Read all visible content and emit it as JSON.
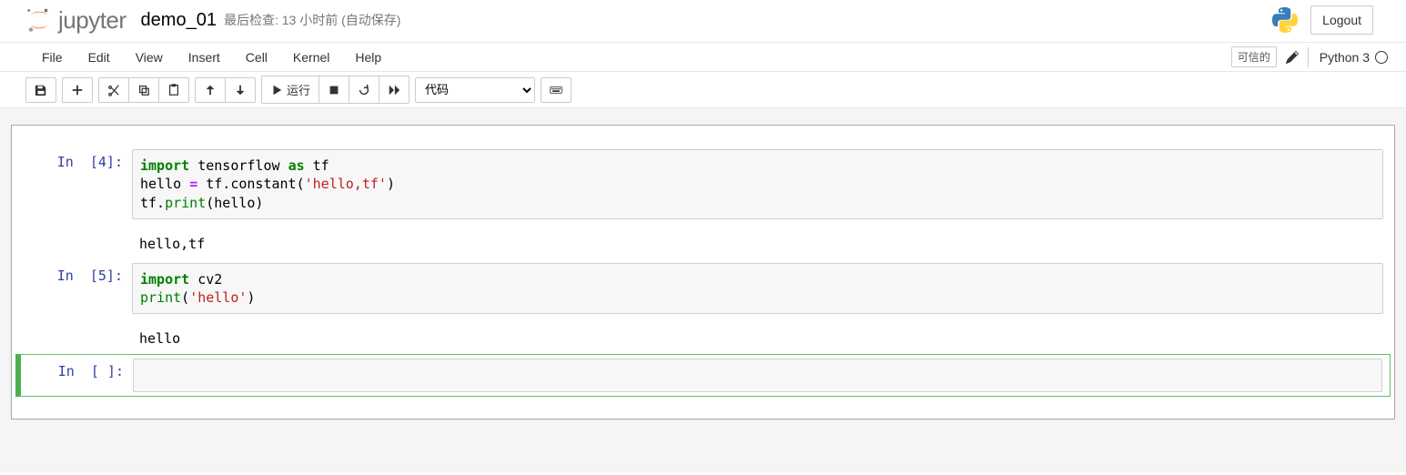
{
  "header": {
    "logo_text": "jupyter",
    "notebook_name": "demo_01",
    "checkpoint": "最后检查: 13 小时前  (自动保存)",
    "logout": "Logout"
  },
  "menubar": {
    "items": [
      "File",
      "Edit",
      "View",
      "Insert",
      "Cell",
      "Kernel",
      "Help"
    ],
    "trusted": "可信的",
    "kernel": "Python 3"
  },
  "toolbar": {
    "run": "运行",
    "celltype": "代码"
  },
  "cells": [
    {
      "prompt": "In  [4]:",
      "code_tokens": [
        [
          {
            "t": "import",
            "c": "kw"
          },
          {
            "t": " tensorflow ",
            "c": "name"
          },
          {
            "t": "as",
            "c": "kw"
          },
          {
            "t": " tf",
            "c": "name"
          }
        ],
        [
          {
            "t": "hello ",
            "c": "name"
          },
          {
            "t": "=",
            "c": "op"
          },
          {
            "t": " tf.constant(",
            "c": "name"
          },
          {
            "t": "'hello,tf'",
            "c": "str"
          },
          {
            "t": ")",
            "c": "name"
          }
        ],
        [
          {
            "t": "tf.",
            "c": "name"
          },
          {
            "t": "print",
            "c": "builtin"
          },
          {
            "t": "(hello)",
            "c": "name"
          }
        ]
      ],
      "output": "hello,tf"
    },
    {
      "prompt": "In  [5]:",
      "code_tokens": [
        [
          {
            "t": "import",
            "c": "kw"
          },
          {
            "t": " cv2",
            "c": "name"
          }
        ],
        [
          {
            "t": "print",
            "c": "builtin"
          },
          {
            "t": "(",
            "c": "name"
          },
          {
            "t": "'hello'",
            "c": "str"
          },
          {
            "t": ")",
            "c": "name"
          }
        ]
      ],
      "output": "hello"
    },
    {
      "prompt": "In  [ ]:",
      "code_tokens": [],
      "output": null,
      "selected": true
    }
  ]
}
